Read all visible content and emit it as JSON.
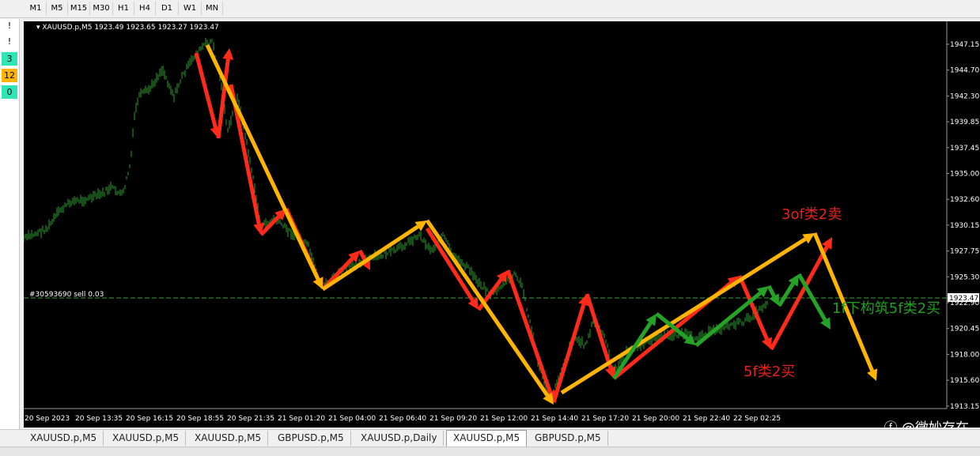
{
  "timeframes": [
    "M1",
    "M5",
    "M15",
    "M30",
    "H1",
    "H4",
    "D1",
    "W1",
    "MN"
  ],
  "side_panel": [
    "!",
    "3",
    "12",
    "0"
  ],
  "chart": {
    "symbol_line": "XAUUSD.p,M5  1923.49 1923.65 1923.27 1923.47",
    "order_label": "#30593690 sell 0.03",
    "current_price": "1923.47",
    "price_labels": [
      "1947.15",
      "1944.70",
      "1942.30",
      "1939.85",
      "1937.45",
      "1935.00",
      "1932.60",
      "1930.15",
      "1927.75",
      "1925.30",
      "1922.90",
      "1920.45",
      "1918.00",
      "1915.60",
      "1913.15"
    ],
    "time_labels": [
      "20 Sep 2023",
      "20 Sep 13:35",
      "20 Sep 16:15",
      "20 Sep 18:55",
      "20 Sep 21:35",
      "21 Sep 01:20",
      "21 Sep 04:00",
      "21 Sep 06:40",
      "21 Sep 09:20",
      "21 Sep 12:00",
      "21 Sep 14:40",
      "21 Sep 17:20",
      "21 Sep 20:00",
      "21 Sep 22:40",
      "22 Sep 02:25"
    ],
    "annotations": {
      "a1": "3of类2卖",
      "a2": "1f下构筑5f类2买",
      "a3": "5f类2买"
    },
    "colors": {
      "bg": "#000000",
      "candle": "#2f9e2f",
      "red": "#ff2a1a",
      "orange": "#ffb400",
      "green": "#26a326"
    }
  },
  "tabs": [
    "XAUUSD.p,M5",
    "XAUUSD.p,M5",
    "XAUUSD.p,M5",
    "GBPUSD.p,M5",
    "XAUUSD.p,Daily",
    "XAUUSD.p,M5",
    "GBPUSD.p,M5"
  ],
  "active_tab": 5,
  "watermark": "ⓕ @微妙存在"
}
